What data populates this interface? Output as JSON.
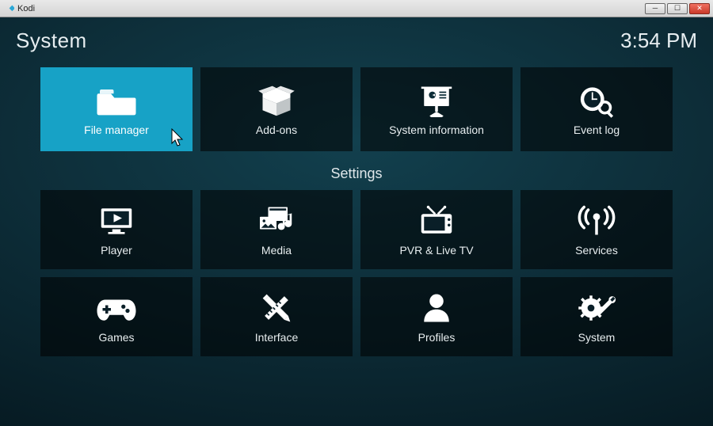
{
  "window": {
    "app_title": "Kodi"
  },
  "header": {
    "page_title": "System",
    "clock": "3:54 PM"
  },
  "top_tiles": [
    {
      "id": "file-manager",
      "label": "File manager",
      "selected": true
    },
    {
      "id": "add-ons",
      "label": "Add-ons",
      "selected": false
    },
    {
      "id": "system-information",
      "label": "System information",
      "selected": false
    },
    {
      "id": "event-log",
      "label": "Event log",
      "selected": false
    }
  ],
  "section_label": "Settings",
  "settings_tiles": [
    {
      "id": "player",
      "label": "Player"
    },
    {
      "id": "media",
      "label": "Media"
    },
    {
      "id": "pvr",
      "label": "PVR & Live TV"
    },
    {
      "id": "services",
      "label": "Services"
    },
    {
      "id": "games",
      "label": "Games"
    },
    {
      "id": "interface",
      "label": "Interface"
    },
    {
      "id": "profiles",
      "label": "Profiles"
    },
    {
      "id": "system",
      "label": "System"
    }
  ],
  "colors": {
    "accent": "#17a2c6",
    "tile_bg": "rgba(0,0,0,0.55)"
  }
}
